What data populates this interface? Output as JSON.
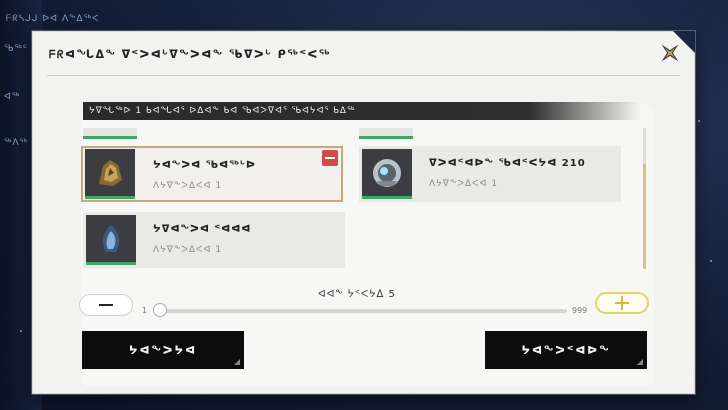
{
  "background": {
    "lines": [
      "ᖴᖇᓴᒍᒍ ᐅᐊ ᐱᖕᐃᖅᐸ",
      "ᖃᖅᑦ",
      "ᐊᖅ",
      "ᖅᐱᖅ"
    ]
  },
  "dialog": {
    "title": "ᖴᖇᐊᖓᐃᖕ ᐁᑉᐳᐊᒡᐁᖕᐳᐊᖕ ᖃᐁᐳᒡ ᑭᖅᑉᐸᖅ",
    "banner": "ᔭᐁᖓᖅᐅ 1 ᑲᐊᖓᐊᕐ ᐅᐃᐊᖕ ᑲᐊ ᖃᐊᐳᐁᐊᕐ ᖃᐊᔭᐊᕐ ᑲᐃᖅ",
    "cards": [
      {
        "name": "ᔭᐊᖕᐳᐊ ᖃᐊᖅᒡᐅ",
        "qty": "ᐱᔭᐁᖕᐳᐃᐸᐊ 1",
        "icon": "bronze-crest-icon",
        "selected": true
      },
      {
        "name": "ᐁᐳᐊᑉᐊᐅᖕ ᖃᐊᑉᐸᔭᐊ 210",
        "qty": "ᐱᔭᐁᖕᐳᐃᐸᐊ 1",
        "icon": "robot-core-icon",
        "selected": false
      },
      {
        "name": "ᔭᐁᐊᖕᐳᐊ ᑉᐊᐊᐊ",
        "qty": "ᐱᔭᐁᖕᐳᐃᐸᐊ 1",
        "icon": "blue-flame-crest-icon",
        "selected": false
      }
    ],
    "quantity_label": "ᐊᐊᖕ ᔭᑉᐸᔭᐃ 5",
    "slider": {
      "min": "1",
      "max": "999",
      "value": 5
    },
    "cancel_label": "ᔭᐊᖕᐳᔭᐊ",
    "confirm_label": "ᔭᐊᖕᐳᑉᐊᐅᖕ"
  },
  "colors": {
    "accent_green": "#3fa66a",
    "accent_gold": "#e2d36a",
    "remove_red": "#d24a4a"
  }
}
